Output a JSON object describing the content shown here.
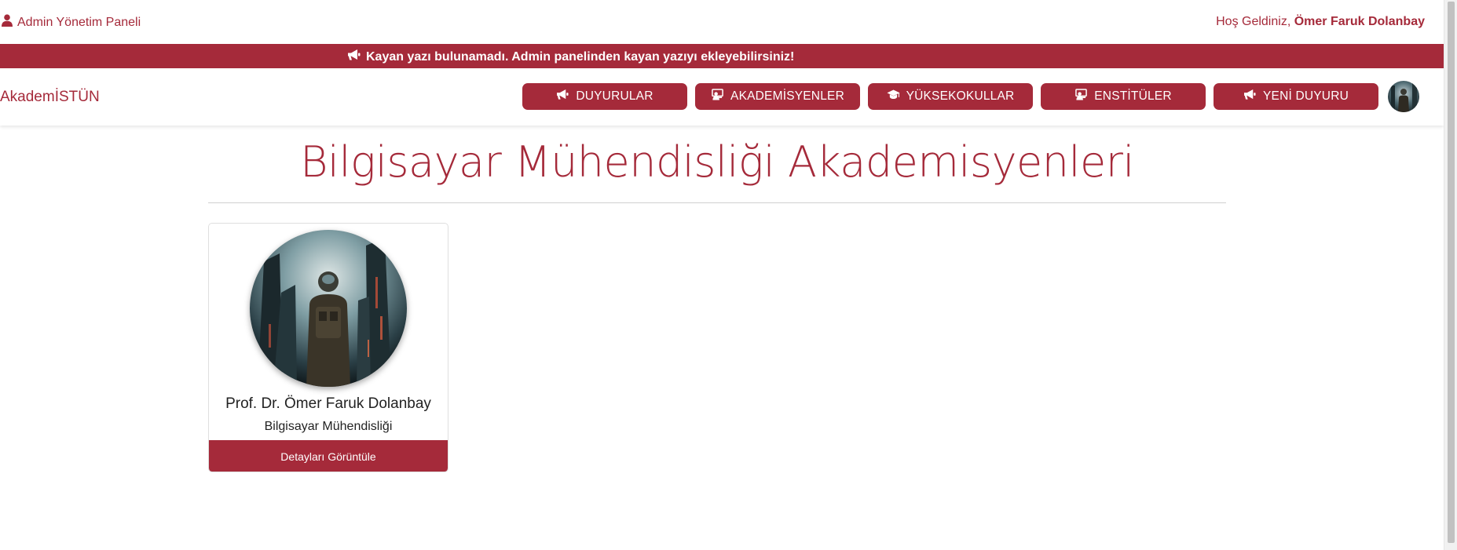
{
  "topbar": {
    "admin_panel_label": "Admin Yönetim Paneli",
    "welcome_prefix": "Hoş Geldiniz,",
    "user_name": "Ömer Faruk Dolanbay"
  },
  "marquee": {
    "text": "Kayan yazı bulunamadı. Admin panelinden kayan yazıyı ekleyebilirsiniz!"
  },
  "navbar": {
    "brand": "AkademİSTÜN",
    "buttons": [
      {
        "label": "DUYURULAR",
        "icon": "megaphone-icon"
      },
      {
        "label": "AKADEMİSYENLER",
        "icon": "teacher-icon"
      },
      {
        "label": "YÜKSEKOKULLAR",
        "icon": "graduation-cap-icon"
      },
      {
        "label": "ENSTİTÜLER",
        "icon": "teacher-icon"
      },
      {
        "label": "YENİ DUYURU",
        "icon": "megaphone-icon"
      }
    ]
  },
  "main": {
    "title": "Bilgisayar Mühendisliği Akademisyenleri",
    "cards": [
      {
        "name": "Prof. Dr. Ömer Faruk Dolanbay",
        "department": "Bilgisayar Mühendisliği",
        "button_label": "Detayları Görüntüle"
      }
    ]
  },
  "colors": {
    "brand": "#a52a3a",
    "text_dark": "#222222",
    "background": "#ffffff"
  }
}
